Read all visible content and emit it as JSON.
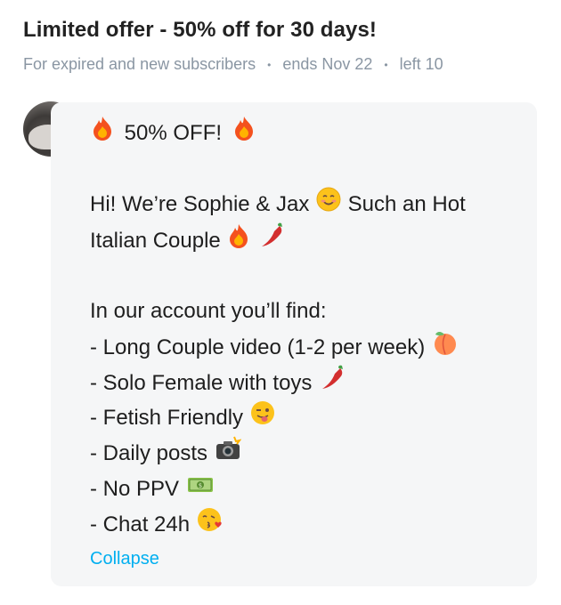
{
  "header": {
    "title": "Limited offer - 50% off for 30 days!",
    "audience": "For expired and new subscribers",
    "ends": "ends Nov 22",
    "left": "left 10"
  },
  "message": {
    "headline": "50% OFF!",
    "intro_line1": "Hi! We’re Sophie & Jax",
    "intro_line1_tail": "Such an Hot",
    "intro_line2": "Italian Couple",
    "list_heading": "In our account you’ll find:",
    "items": [
      "- Long Couple video (1-2 per week)",
      "- Solo Female with toys",
      "- Fetish Friendly",
      "- Daily posts",
      "- No PPV",
      "- Chat 24h"
    ]
  },
  "actions": {
    "collapse_label": "Collapse"
  },
  "icons": {
    "headline_left": "fire-icon",
    "headline_right": "fire-icon",
    "intro": "smiling-face-icon",
    "couple_1": "fire-icon",
    "couple_2": "hot-pepper-icon",
    "item_0": "peach-icon",
    "item_1": "hot-pepper-icon",
    "item_2": "winking-tongue-face-icon",
    "item_3": "camera-flash-icon",
    "item_4": "money-icon",
    "item_5": "kissing-face-icon"
  },
  "colors": {
    "accent": "#00aff0",
    "muted": "#8a96a3",
    "bubble": "#f5f6f7"
  }
}
